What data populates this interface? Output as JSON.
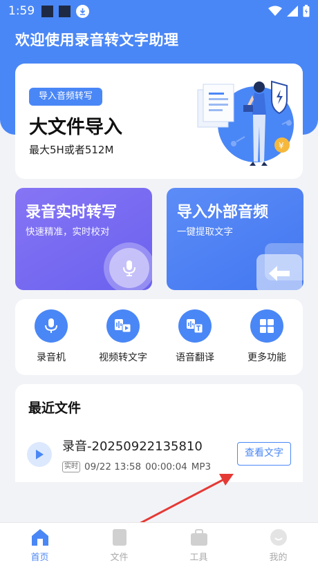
{
  "status_bar": {
    "time": "1:59"
  },
  "app": {
    "title": "欢迎使用录音转文字助理"
  },
  "import_card": {
    "chip": "导入音频转写",
    "title": "大文件导入",
    "subtitle": "最大5H或者512M"
  },
  "features": [
    {
      "title": "录音实时转写",
      "subtitle": "快速精准，实时校对"
    },
    {
      "title": "导入外部音频",
      "subtitle": "一键提取文字"
    }
  ],
  "tools": [
    {
      "label": "录音机",
      "icon": "mic-icon"
    },
    {
      "label": "视频转文字",
      "icon": "video-to-text-icon"
    },
    {
      "label": "语音翻译",
      "icon": "voice-translate-icon"
    },
    {
      "label": "更多功能",
      "icon": "grid-icon"
    }
  ],
  "recent": {
    "title": "最近文件",
    "files": [
      {
        "name": "录音-20250922135810",
        "badge": "实时",
        "date": "09/22 13:58",
        "duration": "00:00:04",
        "format": "MP3",
        "action": "查看文字"
      }
    ]
  },
  "tabs": [
    {
      "label": "首页",
      "active": true
    },
    {
      "label": "文件",
      "active": false
    },
    {
      "label": "工具",
      "active": false
    },
    {
      "label": "我的",
      "active": false
    }
  ],
  "colors": {
    "primary": "#4a87f6",
    "purple": "#7a6cf3",
    "annotation_arrow": "#e53935"
  }
}
